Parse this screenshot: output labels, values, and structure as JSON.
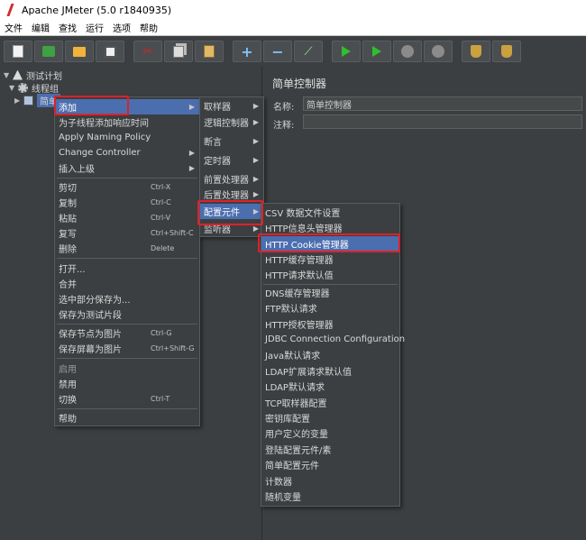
{
  "window": {
    "title": "Apache JMeter (5.0 r1840935)"
  },
  "menubar": [
    "文件",
    "编辑",
    "查找",
    "运行",
    "选项",
    "帮助"
  ],
  "tree": {
    "test_plan": "测试计划",
    "thread_group": "线程组",
    "controller": "简单"
  },
  "form": {
    "title": "简单控制器",
    "name_label": "名称:",
    "name_value": "简单控制器",
    "comment_label": "注释:",
    "comment_value": ""
  },
  "context_menu": {
    "add": "添加",
    "add_think_time": "为子线程添加响应时间",
    "apply_naming": "Apply Naming Policy",
    "change_controller": "Change Controller",
    "insert_parent": "插入上级",
    "cut": "剪切",
    "cut_sc": "Ctrl-X",
    "copy": "复制",
    "copy_sc": "Ctrl-C",
    "paste": "粘贴",
    "paste_sc": "Ctrl-V",
    "duplicate": "复写",
    "duplicate_sc": "Ctrl+Shift-C",
    "remove": "删除",
    "remove_sc": "Delete",
    "open": "打开...",
    "merge": "合并",
    "save_selection": "选中部分保存为...",
    "save_fragment": "保存为测试片段",
    "save_node_image": "保存节点为图片",
    "save_node_image_sc": "Ctrl-G",
    "save_screen_image": "保存屏幕为图片",
    "save_screen_image_sc": "Ctrl+Shift-G",
    "enable": "启用",
    "disable": "禁用",
    "toggle": "切换",
    "toggle_sc": "Ctrl-T",
    "help": "帮助"
  },
  "add_menu": {
    "sampler": "取样器",
    "logic_controller": "逻辑控制器",
    "assertion": "断言",
    "timer": "定时器",
    "pre_processor": "前置处理器",
    "post_processor": "后置处理器",
    "config_element": "配置元件",
    "listener": "监听器"
  },
  "config_menu": [
    "CSV 数据文件设置",
    "HTTP信息头管理器",
    "HTTP Cookie管理器",
    "HTTP缓存管理器",
    "HTTP请求默认值",
    "DNS缓存管理器",
    "FTP默认请求",
    "HTTP授权管理器",
    "JDBC Connection Configuration",
    "Java默认请求",
    "LDAP扩展请求默认值",
    "LDAP默认请求",
    "TCP取样器配置",
    "密钥库配置",
    "用户定义的变量",
    "登陆配置元件/素",
    "简单配置元件",
    "计数器",
    "随机变量"
  ],
  "colors": {
    "background": "#3c3f41",
    "selection": "#4b6eaf",
    "highlight": "#e0202a"
  }
}
